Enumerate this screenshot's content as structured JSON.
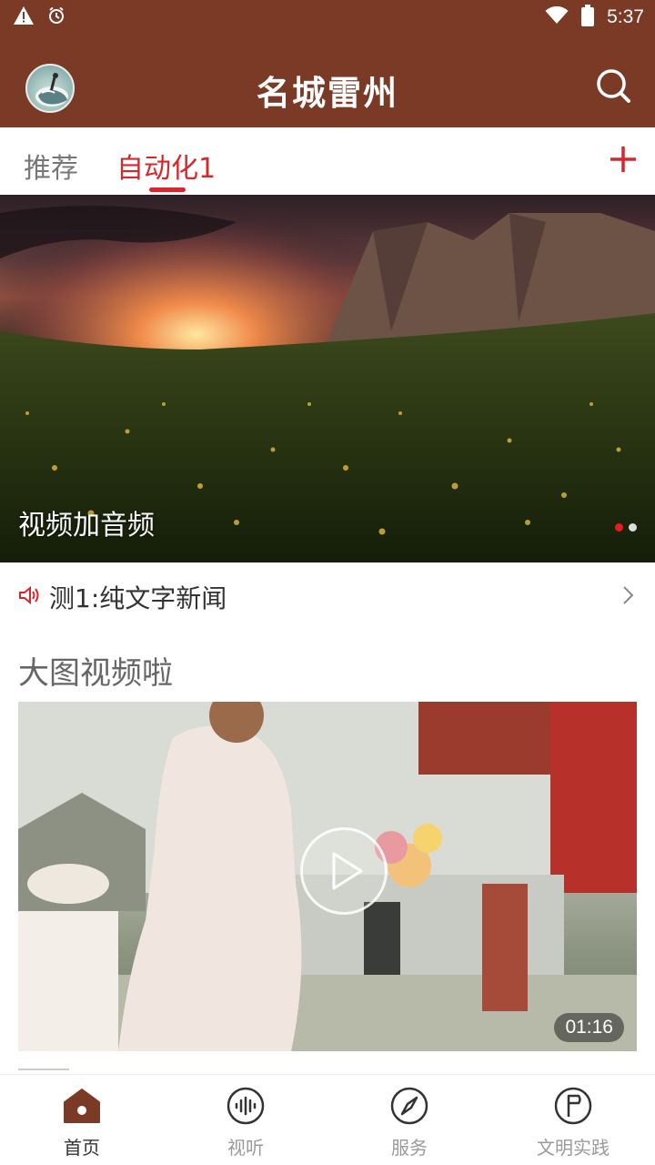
{
  "status_bar": {
    "time": "5:37",
    "icons": [
      "warning-icon",
      "alarm-icon",
      "wifi-icon",
      "battery-icon"
    ]
  },
  "app_bar": {
    "title": "名城雷州",
    "bg_color": "#7a3a26",
    "icons": [
      "avatar-logo",
      "search-icon"
    ]
  },
  "tabs": {
    "items": [
      {
        "label": "推荐",
        "active": false
      },
      {
        "label": "自动化1",
        "active": true
      }
    ],
    "accent_color": "#d7262c",
    "add_icon": "plus-icon"
  },
  "banner": {
    "caption": "视频加音频",
    "slide_count": 2,
    "active_slide": 1
  },
  "ticker": {
    "text": "测1:纯文字新闻",
    "icon": "speaker-icon"
  },
  "section": {
    "title": "大图视频啦"
  },
  "video": {
    "duration": "01:16",
    "icon": "play-icon"
  },
  "bottom_nav": {
    "items": [
      {
        "label": "首页",
        "icon": "home-icon",
        "active": true
      },
      {
        "label": "视听",
        "icon": "audio-wave-icon",
        "active": false
      },
      {
        "label": "服务",
        "icon": "compass-icon",
        "active": false
      },
      {
        "label": "文明实践",
        "icon": "flag-icon",
        "active": false
      }
    ]
  }
}
